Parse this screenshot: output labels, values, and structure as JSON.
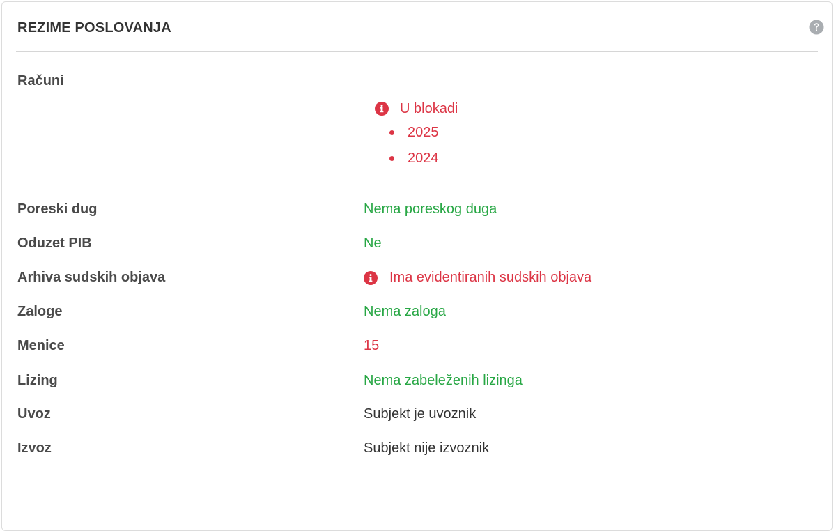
{
  "panel": {
    "title": "REZIME POSLOVANJA",
    "help_icon": "question-circle-icon"
  },
  "accounts": {
    "label": "Računi",
    "status": "U blokadi",
    "status_icon": "exclamation-circle-icon",
    "years": [
      "2025",
      "2024"
    ]
  },
  "rows": [
    {
      "label": "Poreski dug",
      "value": "Nema poreskog duga",
      "tone": "green"
    },
    {
      "label": "Oduzet PIB",
      "value": "Ne",
      "tone": "green"
    },
    {
      "label": "Arhiva sudskih objava",
      "value": "Ima evidentiranih sudskih objava",
      "tone": "red",
      "icon": "exclamation-circle-icon"
    },
    {
      "label": "Zaloge",
      "value": "Nema zaloga",
      "tone": "green"
    },
    {
      "label": "Menice",
      "value": "15",
      "tone": "red"
    },
    {
      "label": "Lizing",
      "value": "Nema zabeleženih lizinga",
      "tone": "green"
    },
    {
      "label": "Uvoz",
      "value": "Subjekt je uvoznik",
      "tone": "dark"
    },
    {
      "label": "Izvoz",
      "value": "Subjekt nije izvoznik",
      "tone": "dark"
    }
  ],
  "colors": {
    "positive": "#28a745",
    "negative": "#dc3545",
    "neutral": "#333333"
  }
}
